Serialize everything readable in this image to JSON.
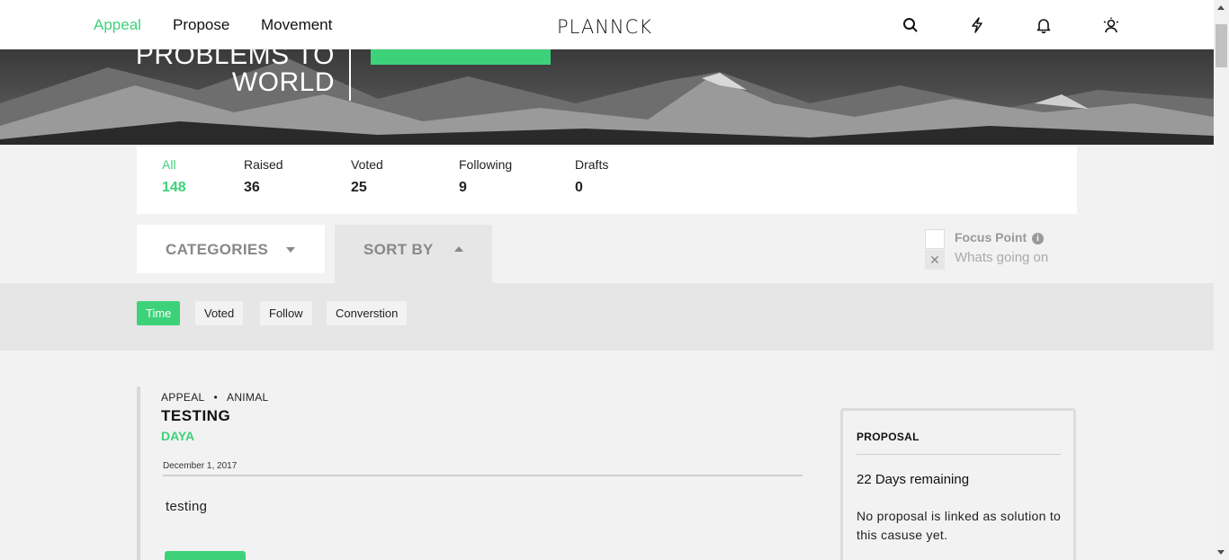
{
  "nav": {
    "links": [
      "Appeal",
      "Propose",
      "Movement"
    ],
    "active": "Appeal",
    "logo": "PLANNCK",
    "icons": [
      "search-icon",
      "lightning-icon",
      "bell-icon",
      "user-icon"
    ]
  },
  "hero": {
    "title_line1": "PROBLEMS TO",
    "title_line2": "WORLD"
  },
  "stats": [
    {
      "label": "All",
      "value": "148"
    },
    {
      "label": "Raised",
      "value": "36"
    },
    {
      "label": "Voted",
      "value": "25"
    },
    {
      "label": "Following",
      "value": "9"
    },
    {
      "label": "Drafts",
      "value": "0"
    }
  ],
  "filters": {
    "categories_label": "CATEGORIES",
    "sort_label": "SORT BY",
    "focus_point_label": "Focus Point",
    "focus_point_placeholder": "Whats going on"
  },
  "sort_options": [
    "Time",
    "Voted",
    "Follow",
    "Converstion"
  ],
  "sort_active": "Time",
  "post": {
    "type": "APPEAL",
    "category": "ANIMAL",
    "separator": "•",
    "title": "TESTING",
    "author": "DAYA",
    "date": "December 1, 2017",
    "body": "testing"
  },
  "proposal": {
    "heading": "PROPOSAL",
    "days_remaining": "22 Days remaining",
    "message": "No proposal is linked as solution to this casuse yet."
  },
  "colors": {
    "accent": "#3dd27a"
  }
}
